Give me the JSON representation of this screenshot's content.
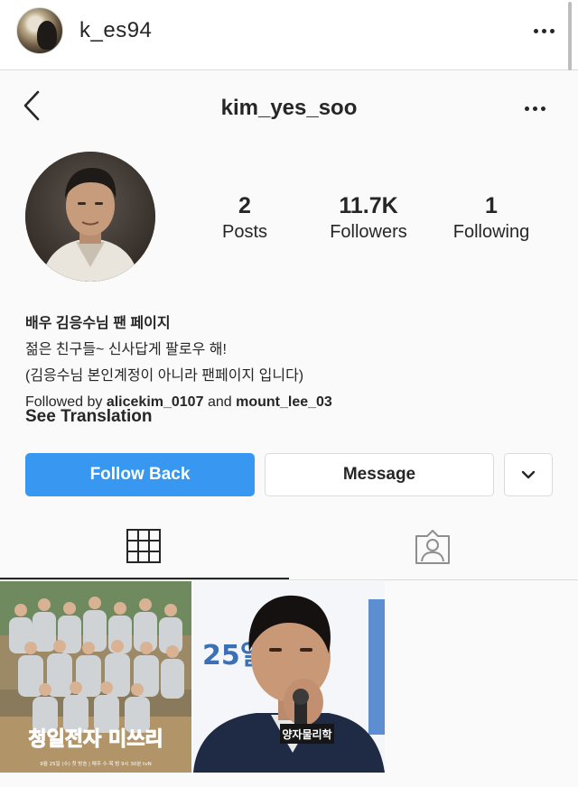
{
  "top": {
    "username": "k_es94"
  },
  "profile": {
    "username": "kim_yes_soo",
    "stats": [
      {
        "value": "2",
        "label": "Posts"
      },
      {
        "value": "11.7K",
        "label": "Followers"
      },
      {
        "value": "1",
        "label": "Following"
      }
    ],
    "bio_name": "배우 김응수님 팬 페이지",
    "bio_lines": [
      "젊은 친구들~ 신사답게 팔로우 해!",
      "(김응수님 본인계정이 아니라 팬페이지 입니다)"
    ],
    "followed_by": {
      "prefix": "Followed by",
      "user1": "alicekim_0107",
      "connector": "and",
      "user2": "mount_lee_03"
    },
    "see_translation": "See Translation"
  },
  "actions": {
    "follow_back": "Follow Back",
    "message": "Message"
  },
  "posts": [
    {
      "title": "청일전자 미쓰리",
      "date_text": "9월 25일 (수) 첫 방송 | 매주 수·목 밤 9시 30분 tvN"
    },
    {
      "date_text": "25일",
      "sign_text": "양자물리학"
    }
  ],
  "colors": {
    "accent": "#3897f0",
    "border": "#dbdbdb",
    "text": "#262626"
  },
  "icons": {
    "back": "chevron-left-icon",
    "more": "more-horizontal-icon",
    "dropdown": "chevron-down-icon",
    "grid": "grid-icon",
    "tagged": "tagged-person-icon"
  }
}
